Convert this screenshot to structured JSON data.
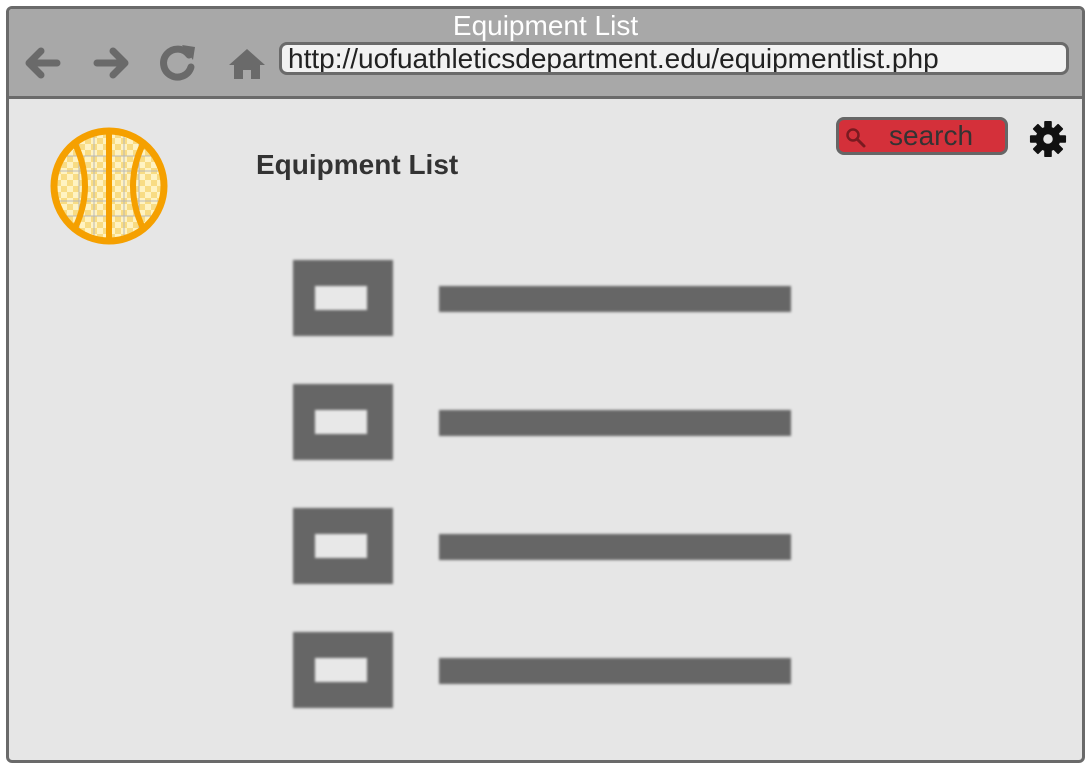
{
  "window": {
    "title": "Equipment List",
    "url": "http://uofuathleticsdepartment.edu/equipmentlist.php"
  },
  "nav": {
    "back_icon": "arrow-left-icon",
    "forward_icon": "arrow-right-icon",
    "reload_icon": "reload-icon",
    "home_icon": "home-icon"
  },
  "header": {
    "logo_icon": "basketball-icon",
    "page_title": "Equipment List",
    "search_label": "search",
    "search_icon": "magnifier-icon",
    "settings_icon": "gear-icon"
  },
  "list": {
    "item_count": 4,
    "item_placeholder_icon": "image-placeholder-icon"
  },
  "colors": {
    "titlebar": "#a8a8a8",
    "page_background": "#e6e6e6",
    "search_accent": "#d4303a",
    "logo_orange": "#f5a000",
    "placeholder_gray": "#666666"
  }
}
